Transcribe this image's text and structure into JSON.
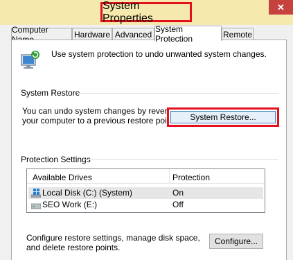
{
  "window": {
    "title": "System Properties",
    "close_glyph": "✕"
  },
  "tabs": [
    {
      "label": "Computer Name",
      "active": false
    },
    {
      "label": "Hardware",
      "active": false
    },
    {
      "label": "Advanced",
      "active": false
    },
    {
      "label": "System Protection",
      "active": true
    },
    {
      "label": "Remote",
      "active": false
    }
  ],
  "intro": {
    "icon": "system-protection-icon",
    "text": "Use system protection to undo unwanted system changes."
  },
  "system_restore": {
    "heading": "System Restore",
    "description_line1": "You can undo system changes by reverting",
    "description_line2": "your computer to a previous restore point.",
    "button_label": "System Restore..."
  },
  "protection": {
    "heading": "Protection Settings",
    "columns": [
      "Available Drives",
      "Protection"
    ],
    "rows": [
      {
        "drive": "Local Disk (C:) (System)",
        "protection": "On",
        "icon": "windows-drive-icon",
        "selected": true
      },
      {
        "drive": "SEO Work (E:)",
        "protection": "Off",
        "icon": "drive-icon",
        "selected": false
      }
    ]
  },
  "configure": {
    "description_line1": "Configure restore settings, manage disk space,",
    "description_line2": "and delete restore points.",
    "button_label": "Configure..."
  },
  "colors": {
    "title_bar": "#f5e9ad",
    "highlight_box": "#e3101d",
    "close_button": "#c7413e"
  }
}
